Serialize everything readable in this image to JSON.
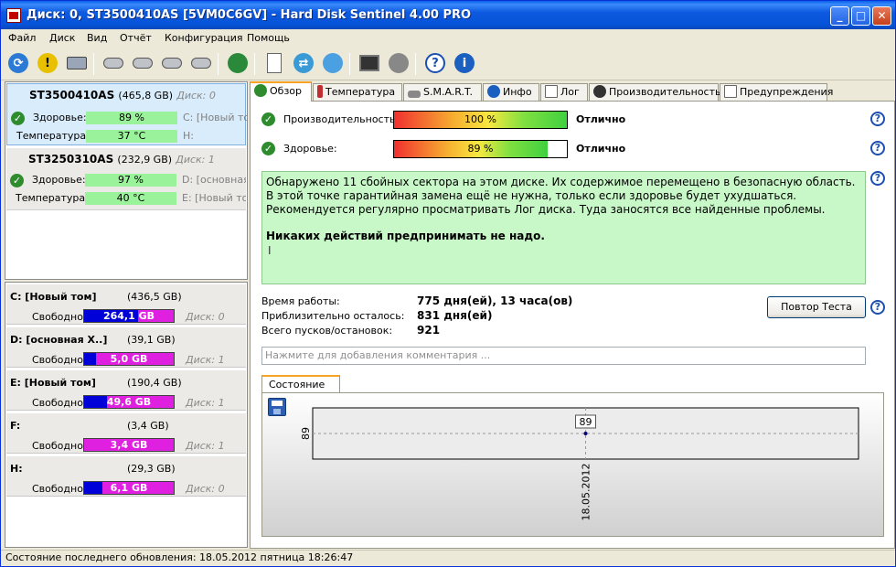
{
  "window": {
    "title": "Диск: 0, ST3500410AS [5VM0C6GV]  -  Hard Disk Sentinel 4.00 PRO"
  },
  "menu": [
    "Файл",
    "Диск",
    "Вид",
    "Отчёт",
    "Конфигурация",
    "Помощь"
  ],
  "disks": [
    {
      "model": "ST3500410AS",
      "capacity": "(465,8 GB)",
      "disk_no": "Диск: 0",
      "health_label": "Здоровье:",
      "health": "89 %",
      "temp_label": "Температура:",
      "temp": "37 °C",
      "vol1": "C: [Новый том",
      "vol2": "H:"
    },
    {
      "model": "ST3250310AS",
      "capacity": "(232,9 GB)",
      "disk_no": "Диск: 1",
      "health_label": "Здоровье:",
      "health": "97 %",
      "temp_label": "Температура:",
      "temp": "40 °C",
      "vol1": "D: [основная",
      "vol2": "E: [Новый том"
    }
  ],
  "partitions": [
    {
      "name": "C: [Новый том]",
      "size": "(436,5 GB)",
      "free_label": "Свободно",
      "free": "264,1 GB",
      "free_fraction": 0.605,
      "disk": "Диск: 0"
    },
    {
      "name": "D: [основная X..]",
      "size": "(39,1 GB)",
      "free_label": "Свободно",
      "free": "5,0 GB",
      "free_fraction": 0.128,
      "disk": "Диск: 1"
    },
    {
      "name": "E: [Новый том]",
      "size": "(190,4 GB)",
      "free_label": "Свободно",
      "free": "49,6 GB",
      "free_fraction": 0.26,
      "disk": "Диск: 1"
    },
    {
      "name": "F:",
      "size": "(3,4 GB)",
      "free_label": "Свободно",
      "free": "3,4 GB",
      "free_fraction": 0.0,
      "disk": "Диск: 1"
    },
    {
      "name": "H:",
      "size": "(29,3 GB)",
      "free_label": "Свободно",
      "free": "6,1 GB",
      "free_fraction": 0.208,
      "disk": "Диск: 0"
    }
  ],
  "tabs": [
    "Обзор",
    "Температура",
    "S.M.A.R.T.",
    "Инфо",
    "Лог",
    "Производительность",
    "Предупреждения"
  ],
  "overview": {
    "perf_label": "Производительность:",
    "perf_value": "100 %",
    "perf_fraction": 1.0,
    "perf_status": "Отлично",
    "health_label": "Здоровье:",
    "health_value": "89 %",
    "health_fraction": 0.89,
    "health_status": "Отлично",
    "message_lines": [
      "Обнаружено 11 сбойных сектора на этом диске. Их содержимое перемещено в безопасную область.",
      "В этой точке гарантийная замена ещё не нужна, только если здоровье будет ухудшаться.",
      "Рекомендуется регулярно просматривать Лог диска. Туда заносятся все найденные проблемы."
    ],
    "message_bold": "Никаких действий предпринимать не надо.",
    "uptime_label": "Время работы:",
    "uptime": "775 дня(ей), 13 часа(ов)",
    "remaining_label": "Приблизительно осталось:",
    "remaining": "831 дня(ей)",
    "starts_label": "Всего пусков/остановок:",
    "starts": "921",
    "retest_button": "Повтор Теста",
    "comment_placeholder": "Нажмите для добавления комментария ...",
    "chart_tab": "Состояние (%)"
  },
  "chart_data": {
    "type": "line",
    "x": [
      "18.05.2012"
    ],
    "series": [
      {
        "values": [
          89
        ]
      }
    ],
    "ytick_labels": [
      "89"
    ],
    "data_labels": [
      "89"
    ]
  },
  "status_bar": "Состояние последнего обновления: 18.05.2012 пятница 18:26:47"
}
